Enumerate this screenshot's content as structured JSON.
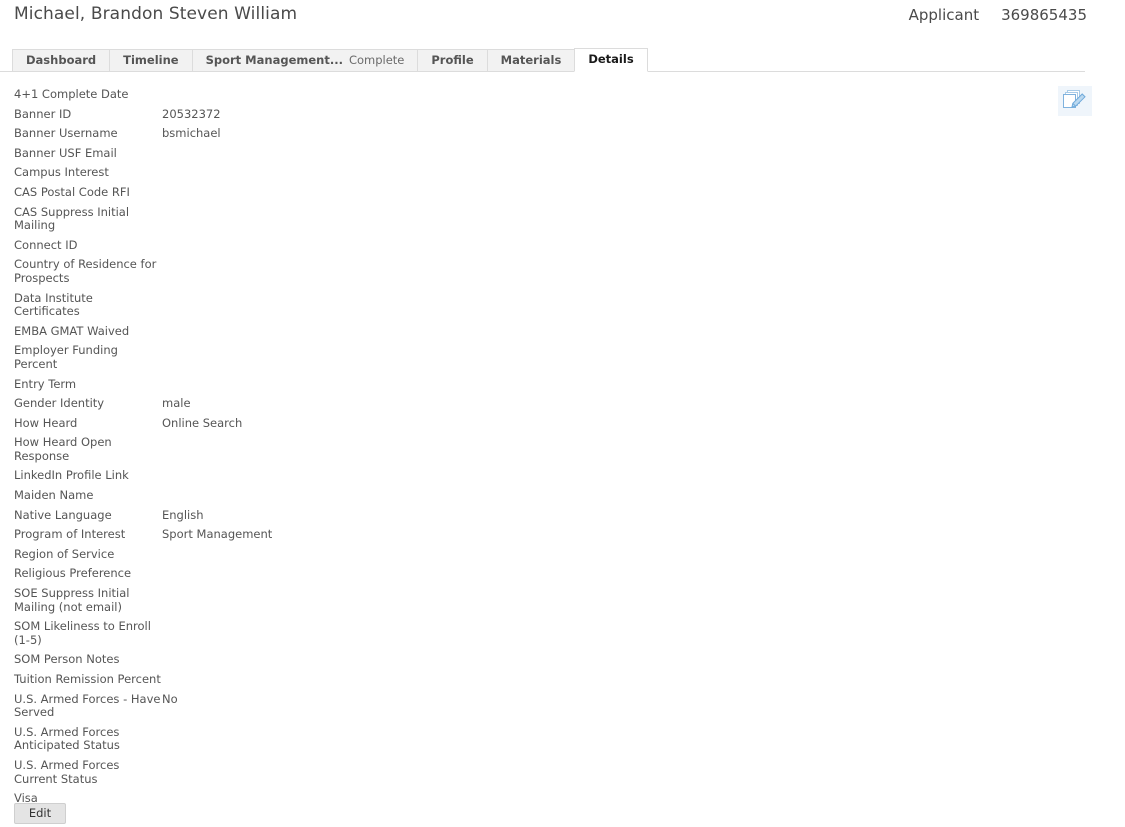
{
  "header": {
    "person_name": "Michael, Brandon Steven William",
    "role": "Applicant",
    "id_number": "369865435"
  },
  "tabs": [
    {
      "label": "Dashboard",
      "sub": "",
      "active": false
    },
    {
      "label": "Timeline",
      "sub": "",
      "active": false
    },
    {
      "label": "Sport Management...",
      "sub": "Complete",
      "active": false
    },
    {
      "label": "Profile",
      "sub": "",
      "active": false
    },
    {
      "label": "Materials",
      "sub": "",
      "active": false
    },
    {
      "label": "Details",
      "sub": "",
      "active": true
    }
  ],
  "panel": {
    "edit_icon_name": "edit-documents-pencil-icon",
    "edit_button_label": "Edit",
    "icon_color": "#a8cbe8"
  },
  "details": [
    {
      "label": "4+1 Complete Date",
      "value": ""
    },
    {
      "label": "Banner ID",
      "value": "20532372"
    },
    {
      "label": "Banner Username",
      "value": "bsmichael"
    },
    {
      "label": "Banner USF Email",
      "value": ""
    },
    {
      "label": "Campus Interest",
      "value": ""
    },
    {
      "label": "CAS Postal Code RFI",
      "value": ""
    },
    {
      "label": "CAS Suppress Initial Mailing",
      "value": ""
    },
    {
      "label": "Connect ID",
      "value": ""
    },
    {
      "label": "Country of Residence for Prospects",
      "value": ""
    },
    {
      "label": "Data Institute Certificates",
      "value": ""
    },
    {
      "label": "EMBA GMAT Waived",
      "value": ""
    },
    {
      "label": "Employer Funding Percent",
      "value": ""
    },
    {
      "label": "Entry Term",
      "value": ""
    },
    {
      "label": "Gender Identity",
      "value": "male"
    },
    {
      "label": "How Heard",
      "value": "Online Search"
    },
    {
      "label": "How Heard Open Response",
      "value": ""
    },
    {
      "label": "LinkedIn Profile Link",
      "value": ""
    },
    {
      "label": "Maiden Name",
      "value": ""
    },
    {
      "label": "Native Language",
      "value": "English"
    },
    {
      "label": "Program of Interest",
      "value": "Sport Management"
    },
    {
      "label": "Region of Service",
      "value": ""
    },
    {
      "label": "Religious Preference",
      "value": ""
    },
    {
      "label": "SOE Suppress Initial Mailing (not email)",
      "value": ""
    },
    {
      "label": "SOM Likeliness to Enroll (1-5)",
      "value": ""
    },
    {
      "label": "SOM Person Notes",
      "value": ""
    },
    {
      "label": "Tuition Remission Percent",
      "value": ""
    },
    {
      "label": "U.S. Armed Forces - Have Served",
      "value": "No"
    },
    {
      "label": "U.S. Armed Forces Anticipated Status",
      "value": ""
    },
    {
      "label": "U.S. Armed Forces Current Status",
      "value": ""
    },
    {
      "label": "Visa",
      "value": ""
    }
  ]
}
